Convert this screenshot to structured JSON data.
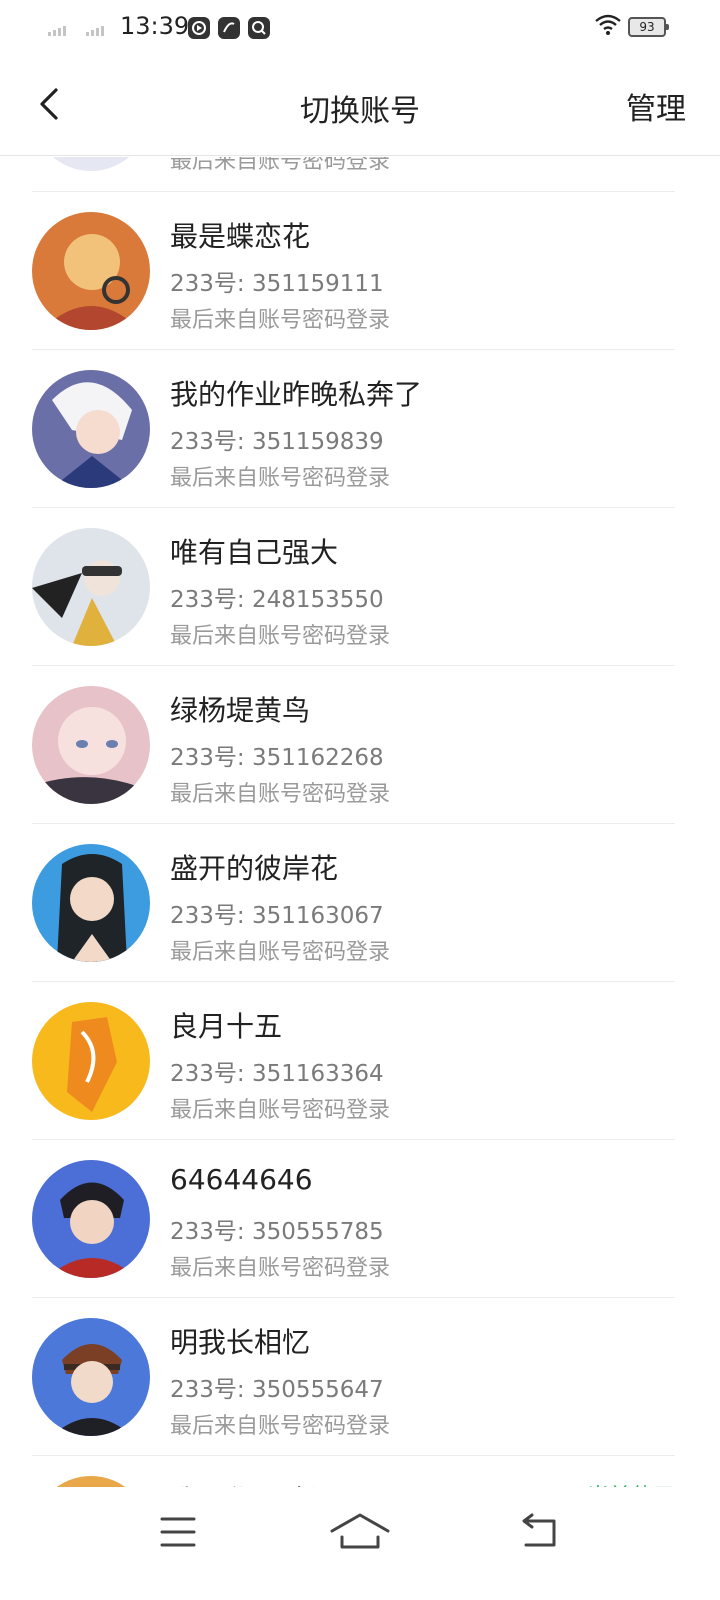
{
  "status_bar": {
    "time": "13:39",
    "battery": "93",
    "icons": [
      "signal-icon",
      "signal-icon",
      "media-play-icon",
      "app-icon",
      "search-app-icon",
      "wifi-icon",
      "battery-icon"
    ]
  },
  "header": {
    "title": "切换账号",
    "manage_label": "管理",
    "back_icon": "chevron-left-icon"
  },
  "partial_top": {
    "meta": "最后来自账号密码登录"
  },
  "accounts": [
    {
      "name": "最是蝶恋花",
      "uid": "233号: 351159111",
      "meta": "最后来自账号密码登录",
      "avatar_color": "#d97a3a"
    },
    {
      "name": "我的作业昨晚私奔了",
      "uid": "233号: 351159839",
      "meta": "最后来自账号密码登录",
      "avatar_color": "#6a6fa8"
    },
    {
      "name": "唯有自己强大",
      "uid": "233号: 248153550",
      "meta": "最后来自账号密码登录",
      "avatar_color": "#cfd3dc"
    },
    {
      "name": "绿杨堤黄鸟",
      "uid": "233号: 351162268",
      "meta": "最后来自账号密码登录",
      "avatar_color": "#e7c3c9"
    },
    {
      "name": "盛开的彼岸花",
      "uid": "233号: 351163067",
      "meta": "最后来自账号密码登录",
      "avatar_color": "#3d9be0"
    },
    {
      "name": "良月十五",
      "uid": "233号: 351163364",
      "meta": "最后来自账号密码登录",
      "avatar_color": "#f7b91c"
    },
    {
      "name": "64644646",
      "uid": "233号: 350555785",
      "meta": "最后来自账号密码登录",
      "avatar_color": "#4b6fd6"
    },
    {
      "name": "明我长相忆",
      "uid": "233号: 350555647",
      "meta": "最后来自账号密码登录",
      "avatar_color": "#4c78d9"
    }
  ],
  "partial_bottom": {
    "name": "我愿作灵清江",
    "current_label": "当前使用",
    "avatar_color": "#e8a84a",
    "accent_color": "#38b36a"
  },
  "nav_bar": {
    "icons": [
      "menu-icon",
      "home-icon",
      "back-nav-icon"
    ]
  }
}
